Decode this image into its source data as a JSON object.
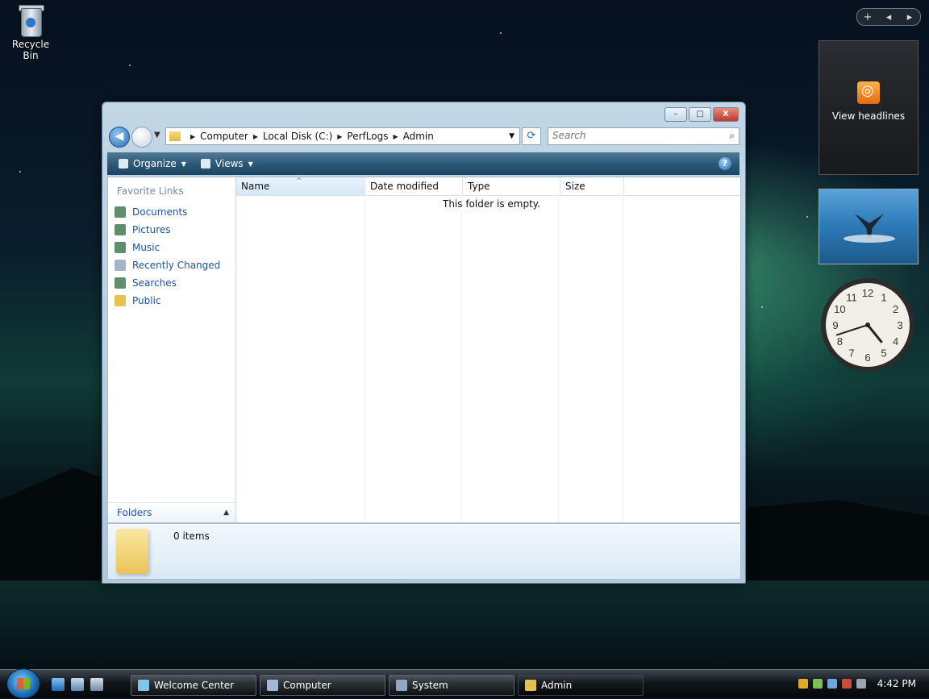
{
  "desktop": {
    "recycle_bin_label": "Recycle Bin"
  },
  "gadgets": {
    "controls": [
      "+",
      "◂",
      "▸"
    ],
    "feed_label": "View headlines",
    "clock": {
      "hour": 4,
      "minute": 42
    }
  },
  "window": {
    "title_buttons": {
      "minimize": "–",
      "maximize": "□",
      "close": "X"
    },
    "breadcrumb": [
      "Computer",
      "Local Disk (C:)",
      "PerfLogs",
      "Admin"
    ],
    "search_placeholder": "Search",
    "toolbar": {
      "organize": "Organize",
      "views": "Views",
      "help": "?"
    },
    "nav": {
      "favorites_header": "Favorite Links",
      "links": [
        {
          "label": "Documents",
          "icon": "documents-icon",
          "color": "#5e8f6c"
        },
        {
          "label": "Pictures",
          "icon": "pictures-icon",
          "color": "#5e8f6c"
        },
        {
          "label": "Music",
          "icon": "music-icon",
          "color": "#5e8f6c"
        },
        {
          "label": "Recently Changed",
          "icon": "recent-icon",
          "color": "#a3b6c8"
        },
        {
          "label": "Searches",
          "icon": "searches-icon",
          "color": "#5e8f6c"
        },
        {
          "label": "Public",
          "icon": "folder-icon",
          "color": "#e6c14d"
        }
      ],
      "folders_label": "Folders"
    },
    "columns": [
      "Name",
      "Date modified",
      "Type",
      "Size"
    ],
    "empty_message": "This folder is empty.",
    "details": {
      "item_count": "0 items"
    }
  },
  "taskbar": {
    "tasks": [
      {
        "label": "Welcome Center",
        "active": false
      },
      {
        "label": "Computer",
        "active": false
      },
      {
        "label": "System",
        "active": false
      },
      {
        "label": "Admin",
        "active": true
      }
    ],
    "time": "4:42 PM"
  },
  "colors": {
    "link": "#1b54a5",
    "command_bar": "#2d5a78",
    "close_button": "#c0392b"
  }
}
